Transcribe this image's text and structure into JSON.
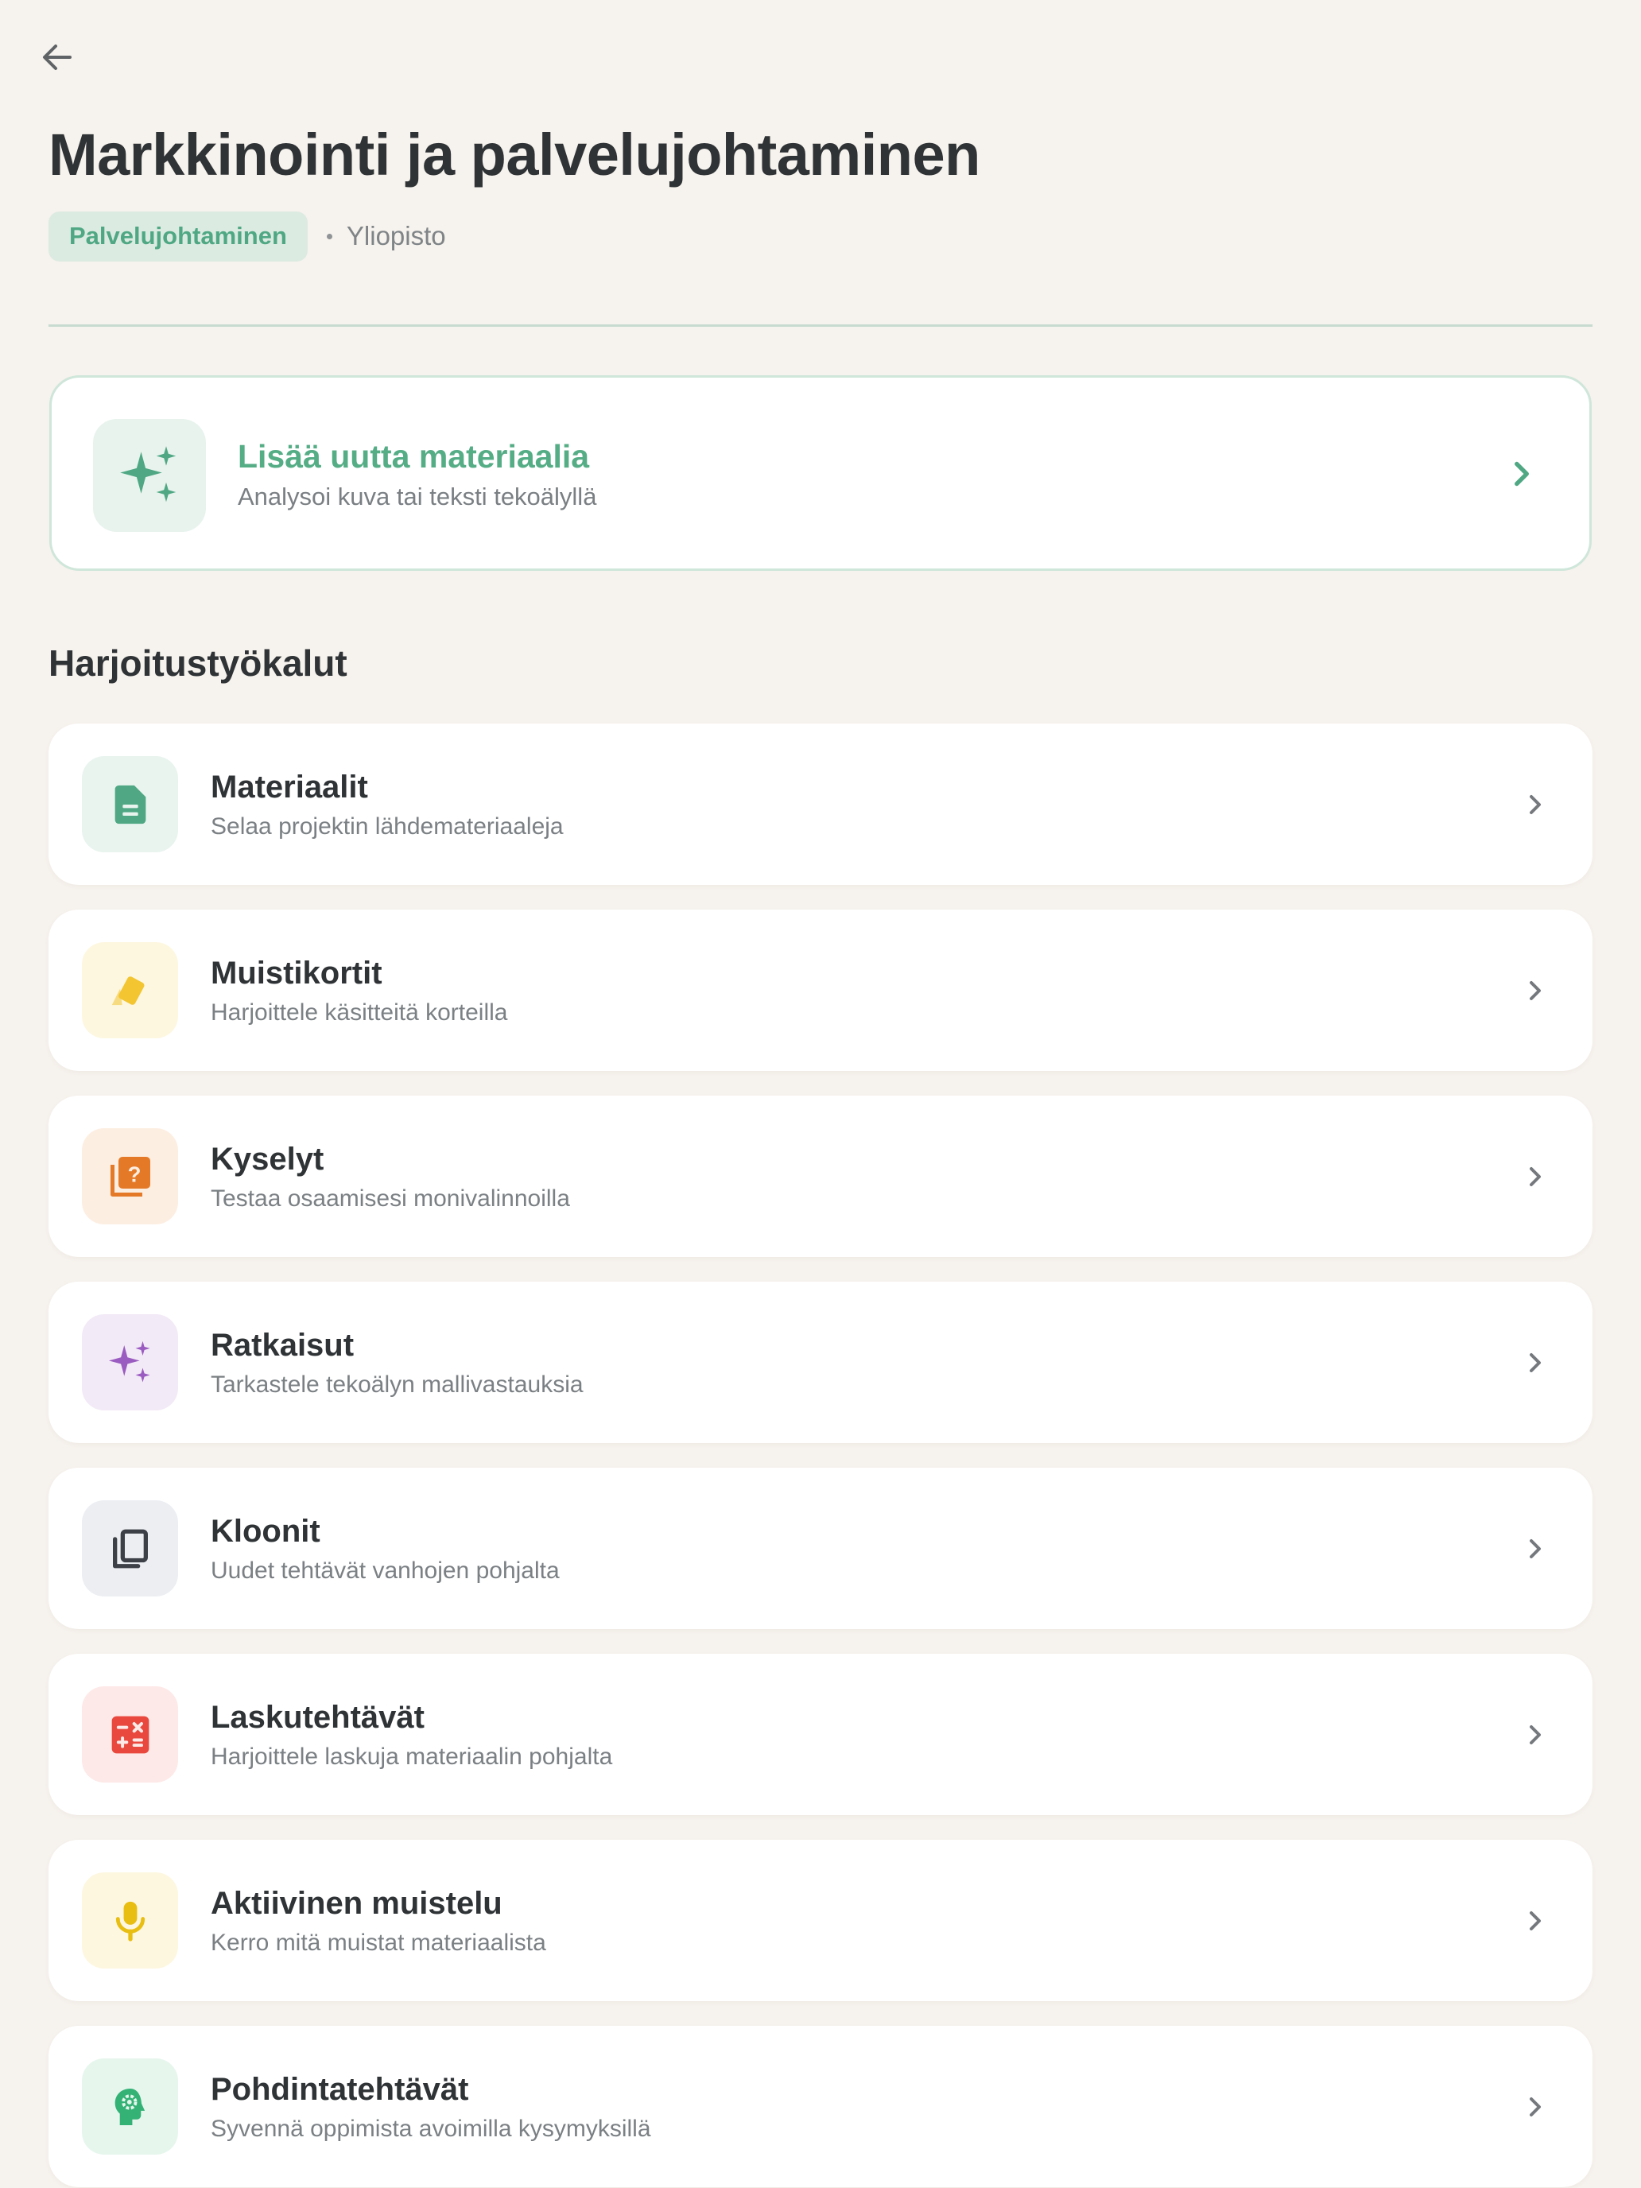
{
  "header": {
    "back_icon": "arrow-left-icon",
    "title": "Markkinointi ja palvelujohtaminen",
    "tag": "Palvelujohtaminen",
    "level": "Yliopisto"
  },
  "ai_card": {
    "icon": "sparkles-icon",
    "title": "Lisää uutta materiaalia",
    "subtitle": "Analysoi kuva tai teksti tekoälyllä"
  },
  "section": {
    "title": "Harjoitustyökalut"
  },
  "tools": [
    {
      "title": "Materiaalit",
      "subtitle": "Selaa projektin lähdemateriaaleja",
      "icon": "document-icon",
      "icon_color": "#4fa883",
      "bg_color": "#e9f4ef"
    },
    {
      "title": "Muistikortit",
      "subtitle": "Harjoittele käsitteitä korteilla",
      "icon": "cards-icon",
      "icon_color": "#f2c531",
      "bg_color": "#fdf7e0"
    },
    {
      "title": "Kyselyt",
      "subtitle": "Testaa osaamisesi monivalinnoilla",
      "icon": "quiz-icon",
      "icon_color": "#e47a28",
      "bg_color": "#fdeee2"
    },
    {
      "title": "Ratkaisut",
      "subtitle": "Tarkastele tekoälyn mallivastauksia",
      "icon": "sparkles-icon",
      "icon_color": "#9a5cc0",
      "bg_color": "#f2eaf6"
    },
    {
      "title": "Kloonit",
      "subtitle": "Uudet tehtävät vanhojen pohjalta",
      "icon": "copy-icon",
      "icon_color": "#3d4147",
      "bg_color": "#eceef2"
    },
    {
      "title": "Laskutehtävät",
      "subtitle": "Harjoittele laskuja materiaalin pohjalta",
      "icon": "calculator-icon",
      "icon_color": "#e8483e",
      "bg_color": "#fde9e7"
    },
    {
      "title": "Aktiivinen muistelu",
      "subtitle": "Kerro mitä muistat materiaalista",
      "icon": "microphone-icon",
      "icon_color": "#e9be12",
      "bg_color": "#fdf7e0"
    },
    {
      "title": "Pohdintatehtävät",
      "subtitle": "Syvennä oppimista avoimilla kysymyksillä",
      "icon": "head-gear-icon",
      "icon_color": "#34b276",
      "bg_color": "#e6f6ed"
    }
  ]
}
